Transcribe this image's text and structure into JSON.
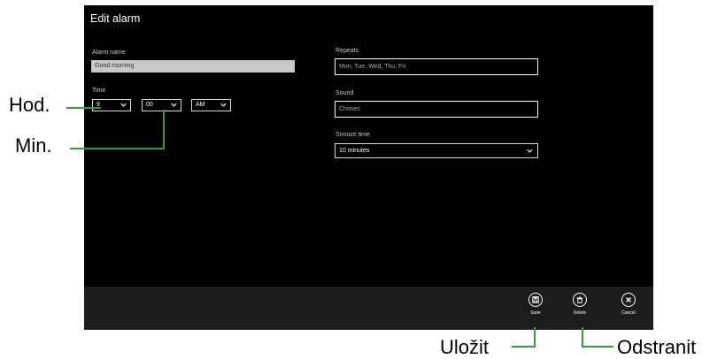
{
  "dialog": {
    "title": "Edit alarm"
  },
  "alarm_name": {
    "label": "Alarm name",
    "value": "Good morning"
  },
  "time": {
    "label": "Time",
    "hour": "9",
    "minute": "00",
    "ampm": "AM"
  },
  "repeats": {
    "label": "Repeats",
    "value": "Mon, Tue, Wed, Thu, Fri"
  },
  "sound": {
    "label": "Sound",
    "value": "Chimes"
  },
  "snooze": {
    "label": "Snooze time",
    "value": "10 minutes"
  },
  "appbar": {
    "save": "Save",
    "delete": "Delete",
    "cancel": "Cancel"
  },
  "callouts": {
    "hour": "Hod.",
    "minute": "Min.",
    "save": "Uložit",
    "delete": "Odstranit"
  },
  "colors": {
    "screen_bg": "#000000",
    "appbar_bg": "#1c1c1c",
    "callout_line": "#3a9a3a"
  },
  "icons": {
    "chevron": "chevron-down-icon",
    "save": "save-icon",
    "delete": "trash-icon",
    "cancel": "close-icon"
  }
}
